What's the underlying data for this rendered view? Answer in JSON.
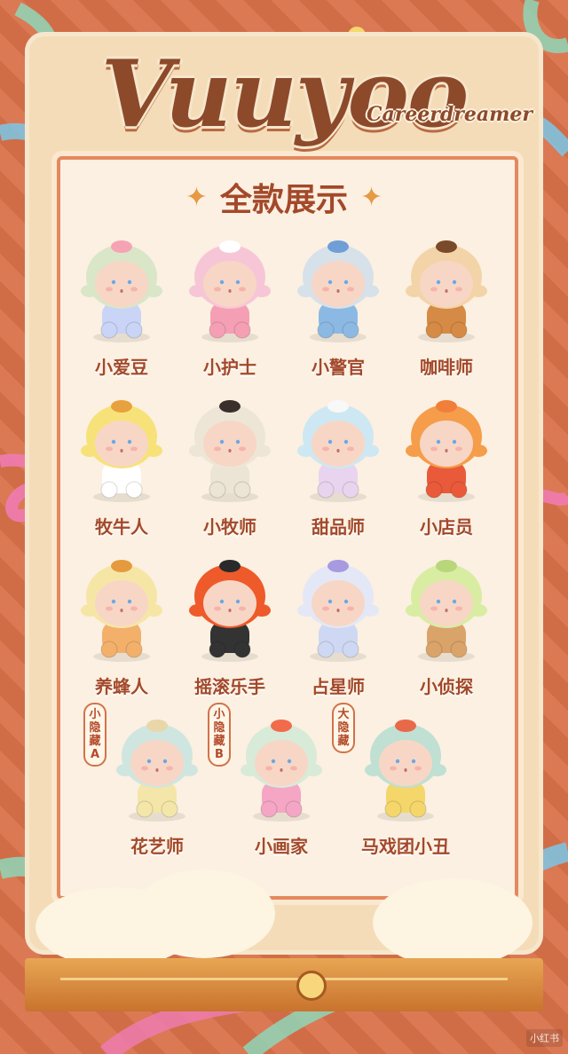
{
  "brand": {
    "logo": "Vuuyoo",
    "subtitle": "Careerdreamer"
  },
  "section_title": "全款展示",
  "figures": [
    {
      "name": "小爱豆",
      "hair": "#d9e6c8",
      "hat": "#f6a3b5",
      "outfit": "#c9d4f7"
    },
    {
      "name": "小护士",
      "hair": "#f7c6d6",
      "hat": "#ffffff",
      "outfit": "#f59fb5"
    },
    {
      "name": "小警官",
      "hair": "#d6e1ea",
      "hat": "#6f9fd6",
      "outfit": "#8cb9e3"
    },
    {
      "name": "咖啡师",
      "hair": "#f3d4a8",
      "hat": "#7a4a2a",
      "outfit": "#d58a45"
    },
    {
      "name": "牧牛人",
      "hair": "#f7e27a",
      "hat": "#e8a13f",
      "outfit": "#ffffff"
    },
    {
      "name": "小牧师",
      "hair": "#ede6d6",
      "hat": "#3a2f2a",
      "outfit": "#ece4d4"
    },
    {
      "name": "甜品师",
      "hair": "#cde8f2",
      "hat": "#f8f8f8",
      "outfit": "#e8d4ee"
    },
    {
      "name": "小店员",
      "hair": "#f59d4a",
      "hat": "#f17f3a",
      "outfit": "#e95a3a"
    },
    {
      "name": "养蜂人",
      "hair": "#f6e6a6",
      "hat": "#e69a3e",
      "outfit": "#f3b06b"
    },
    {
      "name": "摇滚乐手",
      "hair": "#ee5a2a",
      "hat": "#2a2a2a",
      "outfit": "#333333"
    },
    {
      "name": "占星师",
      "hair": "#e4e8f6",
      "hat": "#a79ae0",
      "outfit": "#cfd8f2"
    },
    {
      "name": "小侦探",
      "hair": "#d8eda2",
      "hat": "#b8d67a",
      "outfit": "#d9a36a"
    },
    {
      "name": "花艺师",
      "hair": "#cfe6e0",
      "hat": "#e9d7a9",
      "outfit": "#f3e6a8",
      "tag": "小隐藏A"
    },
    {
      "name": "小画家",
      "hair": "#d8ead8",
      "hat": "#f16b4a",
      "outfit": "#f4a6c4",
      "tag": "小隐藏B"
    },
    {
      "name": "马戏团小丑",
      "hair": "#bfe0d2",
      "hat": "#e8694a",
      "outfit": "#f4d66a",
      "tag": "大隐藏"
    }
  ],
  "watermark": "小红书"
}
